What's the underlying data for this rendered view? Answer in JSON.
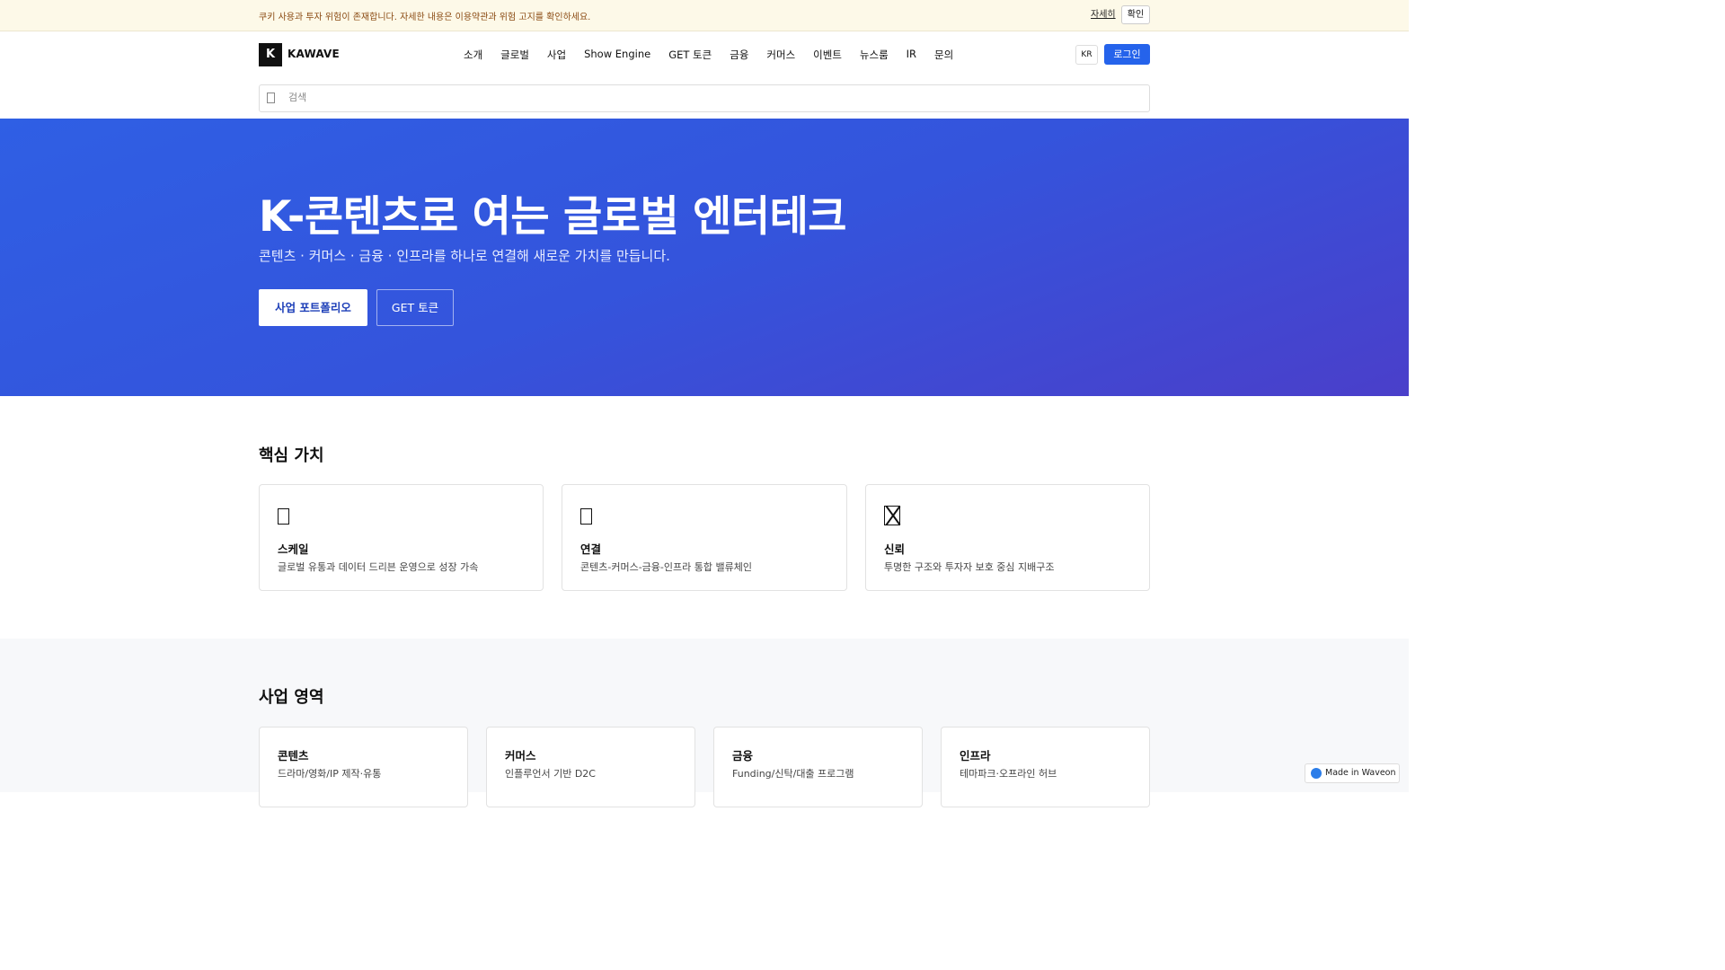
{
  "notice": {
    "message": "쿠키 사용과 투자 위험이 존재합니다. 자세한 내용은 이용약관과 위험 고지를 확인하세요.",
    "more_label": "자세히",
    "confirm_label": "확인"
  },
  "header": {
    "logo_mark": "K",
    "logo_text": "KAWAVE",
    "nav": [
      "소개",
      "글로벌",
      "사업",
      "Show Engine",
      "GET 토큰",
      "금융",
      "커머스",
      "이벤트",
      "뉴스룸",
      "IR",
      "문의"
    ],
    "lang_label": "KR",
    "login_label": "로그인",
    "search_placeholder": "검색"
  },
  "hero": {
    "title": "K-콘텐츠로 여는 글로벌 엔터테크",
    "subtitle": "콘텐츠 · 커머스 · 금융 · 인프라를 하나로 연결해 새로운 가치를 만듭니다.",
    "primary_button": "사업 포트폴리오",
    "secondary_button": "GET 토큰",
    "gradient_start": "#2f5fe4",
    "gradient_end": "#4a3fca"
  },
  "values": {
    "title": "핵심 가치",
    "cards": [
      {
        "icon": "chart-icon",
        "title": "스케일",
        "desc": "글로벌 유통과 데이터 드리븐 운영으로 성장 가속"
      },
      {
        "icon": "link-icon",
        "title": "연결",
        "desc": "콘텐츠-커머스-금융-인프라 통합 밸류체인"
      },
      {
        "icon": "shield-icon",
        "title": "신뢰",
        "desc": "투명한 구조와 투자자 보호 중심 지배구조"
      }
    ]
  },
  "business": {
    "title": "사업 영역",
    "cards": [
      {
        "title": "콘텐츠",
        "desc": "드라마/영화/IP 제작·유통"
      },
      {
        "title": "커머스",
        "desc": "인플루언서 기반 D2C"
      },
      {
        "title": "금융",
        "desc": "Funding/신탁/대출 프로그램"
      },
      {
        "title": "인프라",
        "desc": "테마파크·오프라인 허브"
      }
    ]
  },
  "badge": {
    "label": "Made in Waveon"
  },
  "colors": {
    "accent": "#2563eb",
    "notice_bg": "#fdf9e8",
    "notice_text": "#8a4a12"
  }
}
